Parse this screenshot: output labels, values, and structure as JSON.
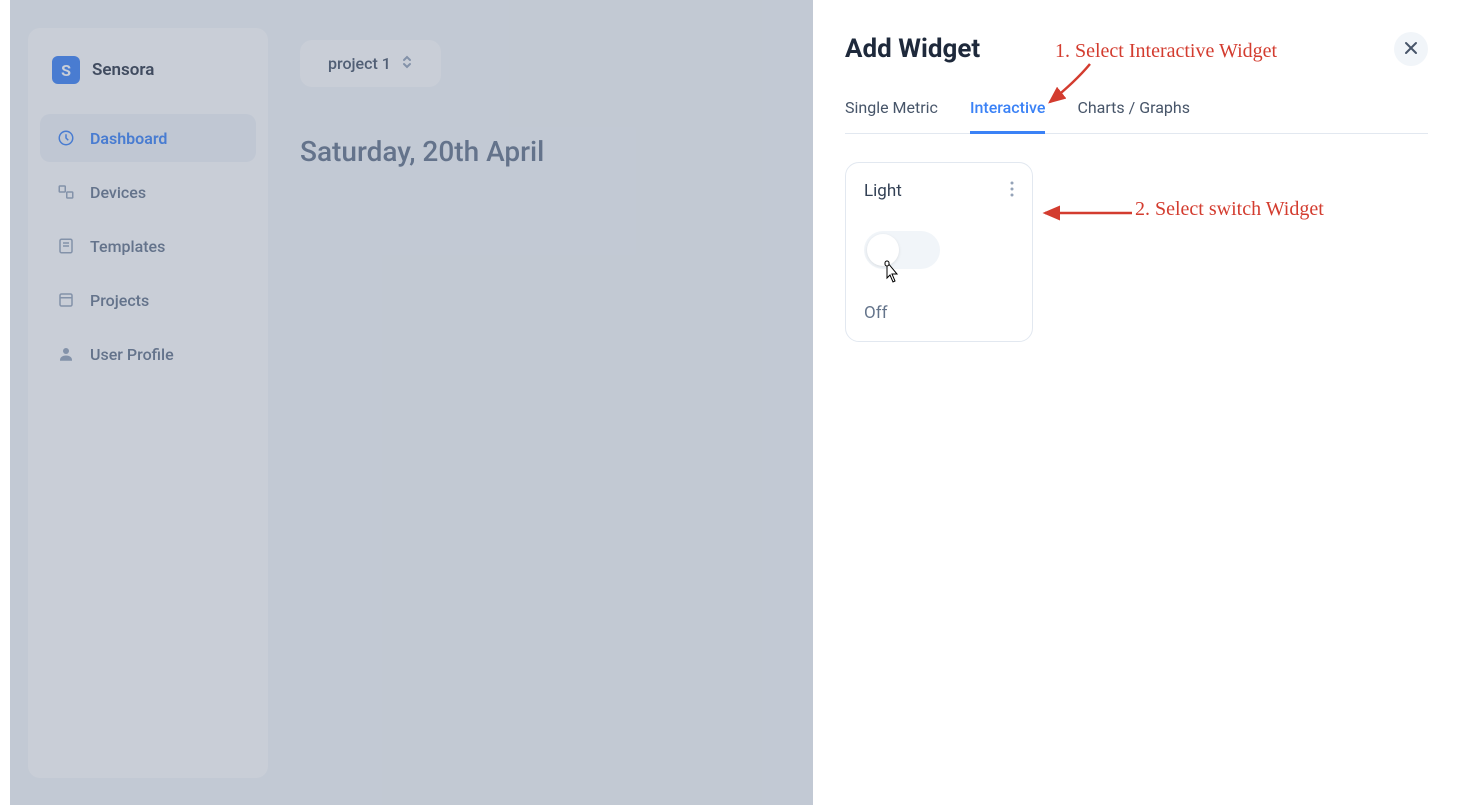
{
  "brand": {
    "name": "Sensora",
    "logo_letter": "S"
  },
  "sidebar": {
    "items": [
      {
        "label": "Dashboard",
        "icon": "dashboard-icon",
        "active": true
      },
      {
        "label": "Devices",
        "icon": "devices-icon",
        "active": false
      },
      {
        "label": "Templates",
        "icon": "templates-icon",
        "active": false
      },
      {
        "label": "Projects",
        "icon": "projects-icon",
        "active": false
      },
      {
        "label": "User Profile",
        "icon": "user-icon",
        "active": false
      }
    ]
  },
  "header": {
    "project_selector": "project 1",
    "date": "Saturday, 20th April"
  },
  "panel": {
    "title": "Add Widget",
    "tabs": [
      {
        "label": "Single Metric",
        "active": false
      },
      {
        "label": "Interactive",
        "active": true
      },
      {
        "label": "Charts / Graphs",
        "active": false
      }
    ],
    "widgets": [
      {
        "title": "Light",
        "state": "Off"
      }
    ]
  },
  "annotations": {
    "step1": "1. Select Interactive Widget",
    "step2": "2. Select switch Widget"
  }
}
